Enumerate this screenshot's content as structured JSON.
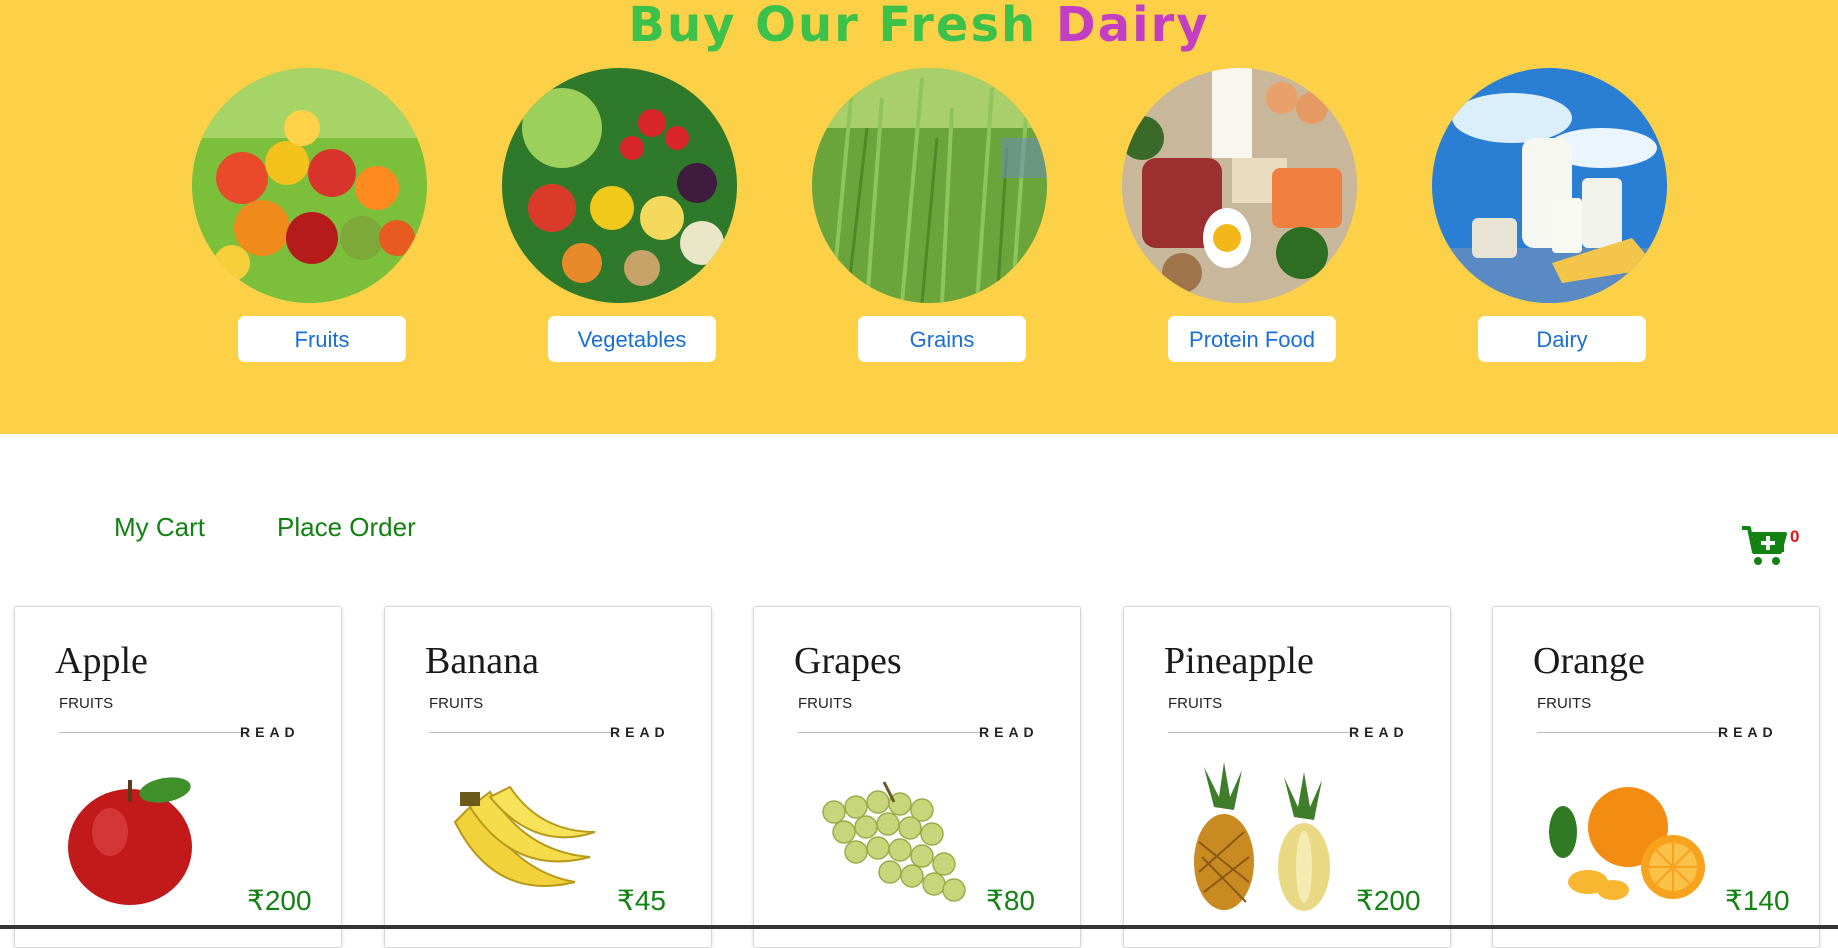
{
  "hero": {
    "title_part1": "Buy Our Fresh ",
    "title_part2": "Dairy",
    "bg_color": "#fcd147"
  },
  "categories": [
    {
      "label": "Fruits"
    },
    {
      "label": "Vegetables"
    },
    {
      "label": "Grains"
    },
    {
      "label": "Protein Food"
    },
    {
      "label": "Dairy"
    }
  ],
  "nav": {
    "my_cart": "My Cart",
    "place_order": "Place Order"
  },
  "cart": {
    "icon": "cart-plus-icon",
    "count": "0"
  },
  "products": [
    {
      "name": "Apple",
      "category": "FRUITS",
      "read": "READ",
      "price": "₹200"
    },
    {
      "name": "Banana",
      "category": "FRUITS",
      "read": "READ",
      "price": "₹45"
    },
    {
      "name": "Grapes",
      "category": "FRUITS",
      "read": "READ",
      "price": "₹80"
    },
    {
      "name": "Pineapple",
      "category": "FRUITS",
      "read": "READ",
      "price": "₹200"
    },
    {
      "name": "Orange",
      "category": "FRUITS",
      "read": "READ",
      "price": "₹140"
    }
  ],
  "colors": {
    "accent_green": "#128212",
    "link_blue": "#1a6fd6",
    "badge_red": "#e01717"
  }
}
